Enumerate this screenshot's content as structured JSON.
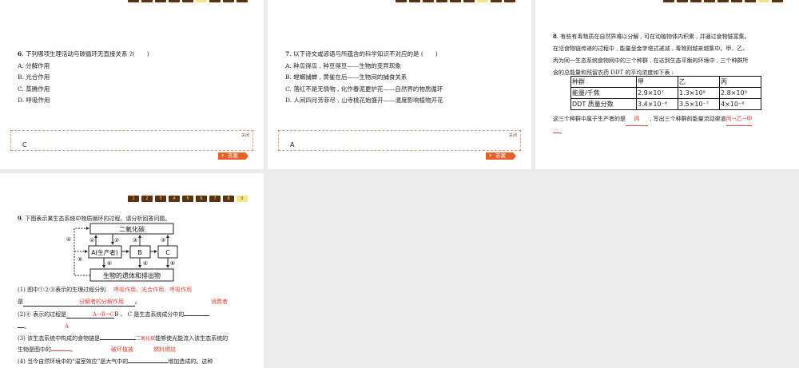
{
  "nav": {
    "pages": [
      "1",
      "2",
      "3",
      "4",
      "5",
      "6",
      "7",
      "8",
      "9"
    ]
  },
  "common": {
    "close": "关闭",
    "answer_button": "答案"
  },
  "q6": {
    "number": "6",
    "stem": ". 下列哪项生理活动与碳循环无直接关系 ?(　　)",
    "options": [
      "A. 分解作用",
      "B. 光合作用",
      "C. 蒸腾作用",
      "D. 呼吸作用"
    ],
    "answer": "C",
    "active_page": 6
  },
  "q7": {
    "number": "7",
    "stem": ". 以下诗文或谚语与所蕴含的科学知识不对应的是 (　　)",
    "options": [
      "A. 种瓜得瓜 , 种豆得豆——生物的变异现象",
      "B. 螳螂捕蝉 , 黄雀在后——生物间的捕食关系",
      "C. 落红不是无情物 , 化作春泥更护花——自然界的物质循环",
      "D. 人间四月芳菲尽 , 山寺桃花始盛开——温度影响植物开花"
    ],
    "answer": "A",
    "active_page": 7
  },
  "q8": {
    "number": "8",
    "stem_lines": [
      ". 有些有毒物质在自然界难以分解 , 可在动植物体内积累 , 并通过食物链富集。",
      "在沿食物链传递的过程中 , 能量呈金字塔式递减 , 毒物则越来越集中。甲、乙、",
      "丙为同一生态系统食物网中的三个种群 , 在达到生态平衡的环境中 , 三个种群所",
      "含的总能量和残留农药 DDT 的平均浓度如下表 :"
    ],
    "table": [
      [
        "种群",
        "甲",
        "乙",
        "丙"
      ],
      [
        "能量/千焦",
        "2.9×10⁷",
        "1.3×10⁸",
        "2.8×10⁹"
      ],
      [
        "DDT 质量分数",
        "3.4×10⁻⁶",
        "3.5×10⁻⁷",
        "4×10⁻⁸"
      ]
    ],
    "follow_a": "这三个种群中属于生产者的是",
    "ans1": "丙",
    "follow_b": " , 写出三个种群的能量流动渠道",
    "ans2": "丙→乙→甲",
    "end": "。",
    "active_page": 8
  },
  "q9": {
    "number": "9",
    "stem": ". 下图表示某生态系统中物质循环的过程。请分析回答问题。",
    "diagram": {
      "co2": "二氧化碳",
      "a": "A(生产者)",
      "b": "B",
      "c": "C",
      "remains": "生物的遗体和排出物",
      "n1": "①",
      "n2": "②",
      "n3": "③",
      "n4": "④",
      "n5": "⑤",
      "n6": "⑥"
    },
    "p1a": "(1) 图中①②③表示的生理过程分别",
    "p1_ans": "呼吸作用、光合作用、呼吸作用",
    "p1b": "是",
    "p1_ans2": "分解者的分解作用",
    "p1c": "。",
    "consumer": "消费者",
    "p2a": "(2)④ 表示的过程是",
    "p2_ans": "A→B→C",
    "p2b": "B 、 C 是生态系统成分中的",
    "p2c": "。",
    "p2_ans2": "A",
    "p3a": "(3) 该生态系统中构成的食物链是",
    "p3_ans": "二氧化碳",
    "p3b": "能够使光能流入该生态系统的",
    "p3c": "生物是图中的",
    "p3d": "。",
    "p3_ans2": "破坏植被",
    "p3_ans3": "燃料燃烧",
    "p4a": "(4) 当今自然环境中的“温室效应”是大气中的",
    "p4b": "增加造成的。这种",
    "active_page": 9
  }
}
